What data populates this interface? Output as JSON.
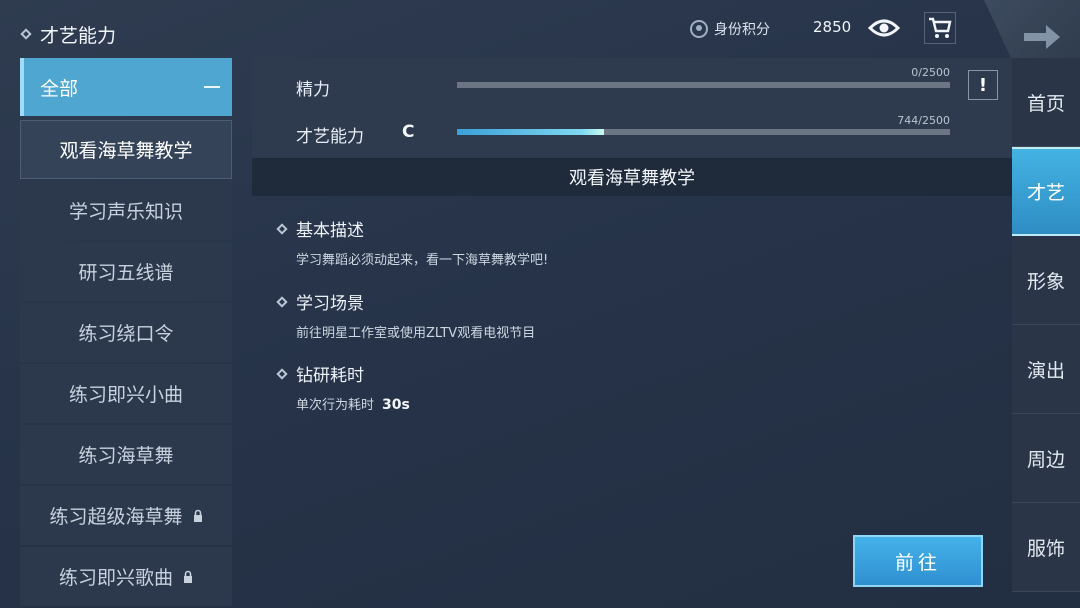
{
  "header": {
    "title": "才艺能力",
    "identity_label": "身份积分",
    "score": "2850"
  },
  "left_list": {
    "all_label": "全部",
    "items": [
      {
        "label": "观看海草舞教学",
        "active": true,
        "locked": false
      },
      {
        "label": "学习声乐知识",
        "active": false,
        "locked": false
      },
      {
        "label": "研习五线谱",
        "active": false,
        "locked": false
      },
      {
        "label": "练习绕口令",
        "active": false,
        "locked": false
      },
      {
        "label": "练习即兴小曲",
        "active": false,
        "locked": false
      },
      {
        "label": "练习海草舞",
        "active": false,
        "locked": false
      },
      {
        "label": "练习超级海草舞",
        "active": false,
        "locked": true
      },
      {
        "label": "练习即兴歌曲",
        "active": false,
        "locked": true
      }
    ]
  },
  "stats": {
    "energy": {
      "label": "精力",
      "value_text": "0/2500",
      "value": 0,
      "max": 2500
    },
    "talent": {
      "label": "才艺能力",
      "grade": "C",
      "value_text": "744/2500",
      "value": 744,
      "max": 2500
    }
  },
  "detail": {
    "title": "观看海草舞教学",
    "sections": [
      {
        "heading": "基本描述",
        "body": "学习舞蹈必须动起来，看一下海草舞教学吧!"
      },
      {
        "heading": "学习场景",
        "body": "前往明星工作室或使用ZLTV观看电视节目"
      },
      {
        "heading": "钻研耗时",
        "body": "单次行为耗时",
        "value": "30s"
      }
    ],
    "go_button": "前往"
  },
  "right_nav": [
    {
      "label": "首页",
      "active": false
    },
    {
      "label": "才艺",
      "active": true
    },
    {
      "label": "形象",
      "active": false
    },
    {
      "label": "演出",
      "active": false
    },
    {
      "label": "周边",
      "active": false
    },
    {
      "label": "服饰",
      "active": false
    }
  ],
  "colors": {
    "accent": "#4fa6d1",
    "background": "#283446"
  }
}
